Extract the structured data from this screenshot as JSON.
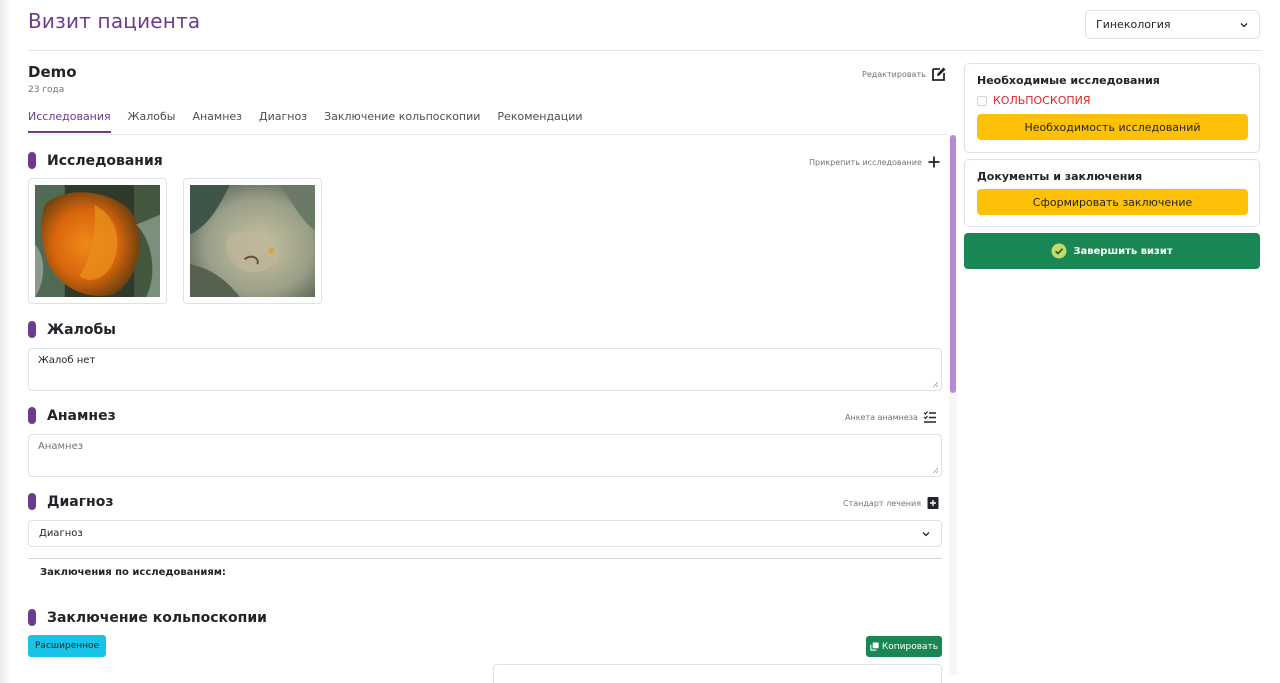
{
  "header": {
    "title": "Визит пациента",
    "specialty_value": "Гинекология"
  },
  "patient": {
    "name": "Demo",
    "age": "23 года",
    "edit_label": "Редактировать"
  },
  "tabs": [
    {
      "label": "Исследования",
      "active": true
    },
    {
      "label": "Жалобы",
      "active": false
    },
    {
      "label": "Анамнез",
      "active": false
    },
    {
      "label": "Диагноз",
      "active": false
    },
    {
      "label": "Заключение кольпоскопии",
      "active": false
    },
    {
      "label": "Рекомендации",
      "active": false
    }
  ],
  "studies": {
    "title": "Исследования",
    "attach_label": "Прикрепить исследование",
    "images": [
      {
        "icon": "colposcopy-image-1"
      },
      {
        "icon": "colposcopy-image-2"
      }
    ]
  },
  "complaints": {
    "title": "Жалобы",
    "value": "Жалоб нет"
  },
  "anamnesis": {
    "title": "Анамнез",
    "questionnaire_label": "Анкета анамнеза",
    "placeholder": "Анамнез"
  },
  "diagnosis": {
    "title": "Диагноз",
    "standard_label": "Стандарт лечения",
    "select_value": "Диагноз",
    "conclusions_label": "Заключения по исследованиям:"
  },
  "colposcopy": {
    "title": "Заключение кольпоскопии",
    "extended_badge": "Расширенное",
    "copy_label": "Копировать"
  },
  "sidebar": {
    "required": {
      "title": "Необходимые исследования",
      "item_label": "КОЛЬПОСКОПИЯ",
      "button_label": "Необходимость исследований"
    },
    "documents": {
      "title": "Документы и заключения",
      "button_label": "Сформировать заключение"
    },
    "finish_label": "Завершить визит"
  },
  "colors": {
    "brand": "#6f3a8c",
    "warning": "#ffc107",
    "success": "#198754",
    "info": "#17c3e6",
    "danger": "#dc2626"
  }
}
